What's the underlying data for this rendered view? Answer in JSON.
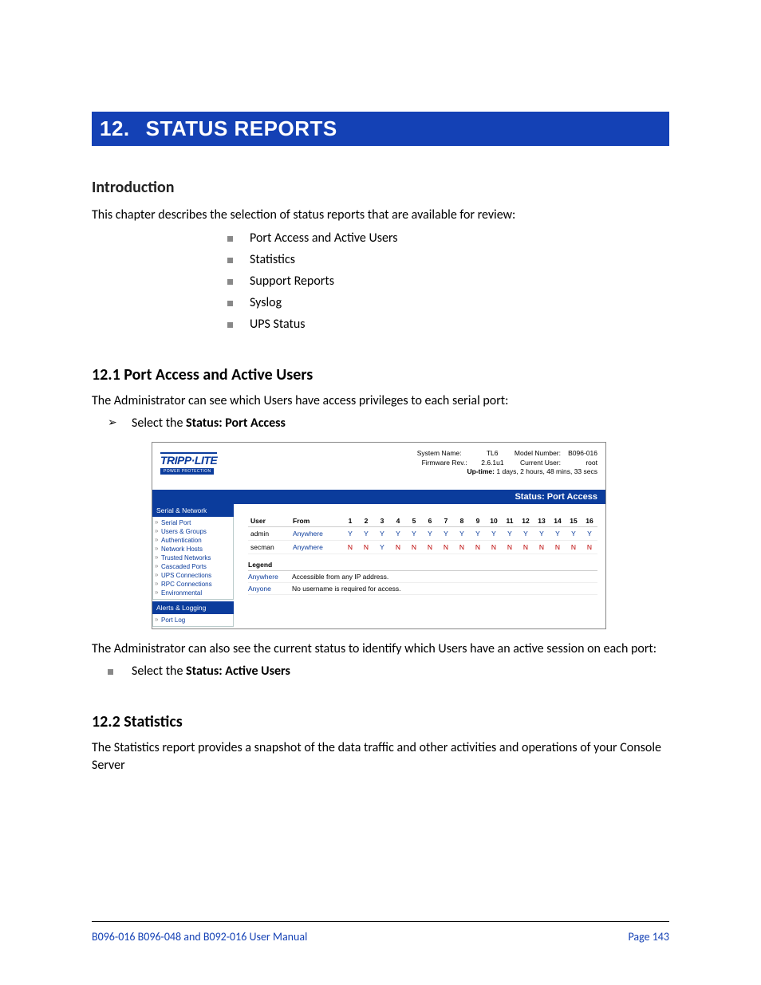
{
  "chapter": {
    "num": "12.",
    "title": "STATUS REPORTS"
  },
  "intro": {
    "heading": "Introduction",
    "lead": "This chapter describes the selection of status reports that are available for review:",
    "bullets": [
      "Port Access and Active Users",
      "Statistics",
      "Support Reports",
      "Syslog",
      "UPS Status"
    ]
  },
  "sec1": {
    "heading": "12.1   Port Access and Active Users",
    "p1": "The Administrator can see which Users have access privileges to each serial port:",
    "step_prefix": "Select the ",
    "step_bold": "Status: Port Access",
    "p2": "The Administrator can also see the current status to identify which Users have an active session on each port:",
    "step2_prefix": "Select the ",
    "step2_bold": "Status: Active Users"
  },
  "sec2": {
    "heading": "12.2   Statistics",
    "p1": "The Statistics report provides a snapshot of the data traffic and other activities and operations of your Console Server"
  },
  "figure": {
    "logo": "TRIPP·LITE",
    "logo_sub": "POWER PROTECTION",
    "stats": {
      "system_name_lbl": "System Name:",
      "system_name_val": "TL6",
      "model_lbl": "Model Number:",
      "model_val": "B096-016",
      "fw_lbl": "Firmware Rev.:",
      "fw_val": "2.6.1u1",
      "user_lbl": "Current User:",
      "user_val": "root",
      "uptime_lbl": "Up-time:",
      "uptime_val": "1 days, 2 hours, 48 mins, 33 secs"
    },
    "titlebar": "Status: Port Access",
    "sidebar": {
      "group1": "Serial & Network",
      "items1": [
        "Serial Port",
        "Users & Groups",
        "Authentication",
        "Network Hosts",
        "Trusted Networks",
        "Cascaded Ports",
        "UPS Connections",
        "RPC Connections",
        "Environmental"
      ],
      "group2": "Alerts & Logging",
      "items2": [
        "Port Log"
      ]
    },
    "table": {
      "headers": {
        "user": "User",
        "from": "From"
      },
      "cols": [
        "1",
        "2",
        "3",
        "4",
        "5",
        "6",
        "7",
        "8",
        "9",
        "10",
        "11",
        "12",
        "13",
        "14",
        "15",
        "16"
      ],
      "rows": [
        {
          "user": "admin",
          "from": "Anywhere",
          "yn": [
            "Y",
            "Y",
            "Y",
            "Y",
            "Y",
            "Y",
            "Y",
            "Y",
            "Y",
            "Y",
            "Y",
            "Y",
            "Y",
            "Y",
            "Y",
            "Y"
          ]
        },
        {
          "user": "secman",
          "from": "Anywhere",
          "yn": [
            "N",
            "N",
            "Y",
            "N",
            "N",
            "N",
            "N",
            "N",
            "N",
            "N",
            "N",
            "N",
            "N",
            "N",
            "N",
            "N"
          ]
        }
      ]
    },
    "legend": {
      "heading": "Legend",
      "rows": [
        {
          "k": "Anywhere",
          "v": "Accessible from any IP address."
        },
        {
          "k": "Anyone",
          "v": "No username is required for access."
        }
      ]
    }
  },
  "footer": {
    "left": "B096-016 B096-048 and B092-016 User Manual",
    "right": "Page 143"
  }
}
